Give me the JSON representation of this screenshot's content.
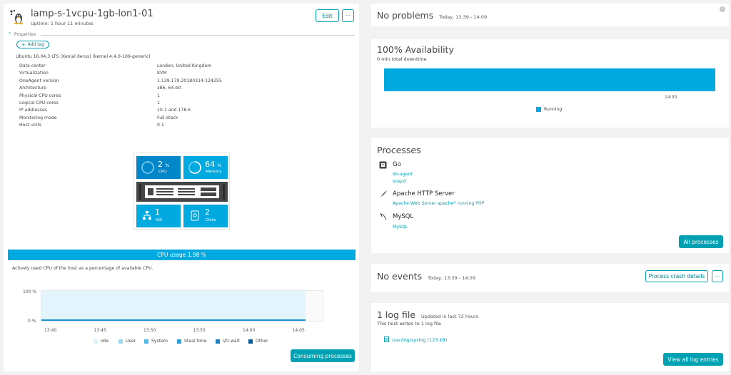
{
  "colors": {
    "accent": "#00a1b2",
    "tile": "#00a9e0",
    "tile_dark": "#0086c9",
    "cpu_bar": "#00a9e0",
    "availability": "#00a9e0"
  },
  "host": {
    "name": "lamp-s-1vcpu-1gb-lon1-01",
    "uptime": "Uptime: 1 hour 11 minutes",
    "icon": "linux-tux-icon",
    "edit_label": "Edit",
    "more_label": "···",
    "properties_label": "Properties",
    "add_tag_label": "Add tag",
    "os": "Ubuntu 16.04.3 LTS (Xenial Xerus) (kernel 4.4.0-109-generic)"
  },
  "properties": [
    {
      "key": "Data center",
      "value": "London, United Kingdom"
    },
    {
      "key": "Virtualization",
      "value": "KVM"
    },
    {
      "key": "OneAgent version",
      "value": "1.139.179.20180314-124255"
    },
    {
      "key": "Architecture",
      "value": "x86, 64-bit"
    },
    {
      "key": "Physical CPU cores",
      "value": "1"
    },
    {
      "key": "Logical CPU cores",
      "value": "1"
    },
    {
      "key": "IP addresses",
      "value": "10.1        and 178.6"
    },
    {
      "key": "Monitoring mode",
      "value": "Full-stack"
    },
    {
      "key": "Host units",
      "value": "0.1"
    }
  ],
  "infographic": {
    "cpu_value": "2",
    "cpu_unit": "%",
    "cpu_label": "CPU",
    "cpu_fraction": 0.02,
    "memory_value": "64",
    "memory_unit": "%",
    "memory_label": "Memory",
    "memory_fraction": 0.64,
    "nic_value": "1",
    "nic_label": "NIC",
    "disks_value": "2",
    "disks_label": "Disks"
  },
  "cpu_usage": {
    "bar_label": "CPU usage 1.98 %",
    "description": "Actively used CPU of the host as a percentage of available CPU.",
    "consuming_label": "Consuming processes"
  },
  "chart_data": {
    "type": "area",
    "x": [
      "13:40",
      "13:45",
      "13:50",
      "13:55",
      "14:00",
      "14:05"
    ],
    "yticks": [
      "100 %",
      "0 %"
    ],
    "ylim": [
      0,
      100
    ],
    "series": [
      {
        "name": "Idle",
        "color": "#dff3fb"
      },
      {
        "name": "User",
        "color": "#9ad8f2"
      },
      {
        "name": "System",
        "color": "#4fb8e8"
      },
      {
        "name": "Steal time",
        "color": "#2a9fd6"
      },
      {
        "name": "I/O wait",
        "color": "#1f7fc0"
      },
      {
        "name": "Other",
        "color": "#0b5b96"
      }
    ]
  },
  "problems": {
    "title": "No problems",
    "range": "Today, 13:39 - 14:09",
    "info_icon": "info-icon"
  },
  "availability": {
    "title": "100% Availability",
    "downtime": "0 min total downtime",
    "tick": "14:00",
    "legend": "Running",
    "running_fraction": 1.0
  },
  "processes": {
    "title": "Processes",
    "groups": [
      {
        "name": "Go",
        "icon": "go-icon",
        "items": [
          "do-agent",
          "snapd"
        ]
      },
      {
        "name": "Apache HTTP Server",
        "icon": "apache-feather-icon",
        "items": [
          "Apache Web Server apache* running PHP"
        ]
      },
      {
        "name": "MySQL",
        "icon": "mysql-dolphin-icon",
        "items": [
          "MySQL"
        ]
      }
    ],
    "all_label": "All processes"
  },
  "events": {
    "title": "No events",
    "range": "Today, 13:39 - 14:09",
    "crash_label": "Process crash details",
    "more_label": "···"
  },
  "logs": {
    "title": "1 log file",
    "updated": "Updated in last 72 hours",
    "subtitle": "This host writes to 1 log file",
    "file": "/var/log/syslog (123 kB)",
    "view_all_label": "View all log entries"
  }
}
